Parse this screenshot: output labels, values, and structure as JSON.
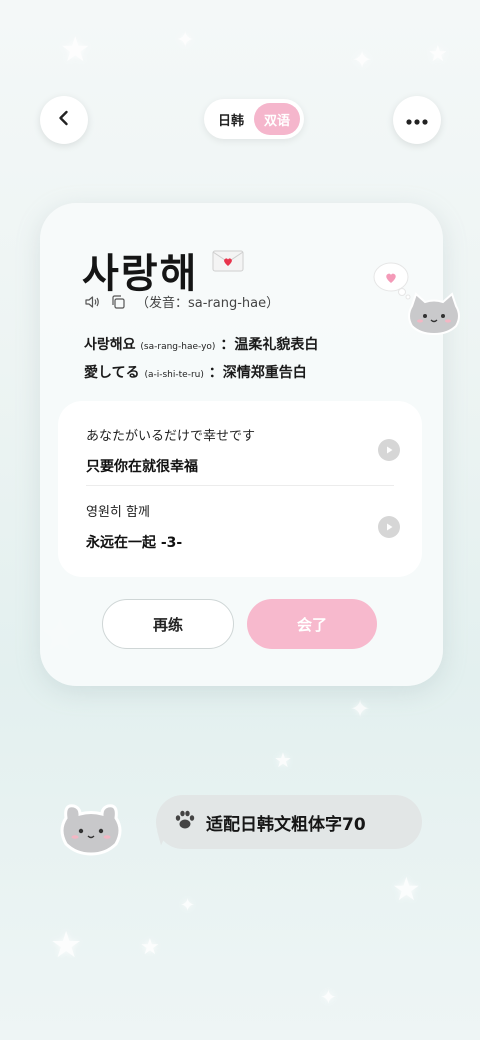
{
  "header": {
    "toggle": {
      "option_a": "日韩",
      "option_b": "双语",
      "active": "option_b"
    }
  },
  "card": {
    "word": "사랑해",
    "pronunciation": "（发音：sa-rang-hae）",
    "forms": [
      {
        "text": "사랑해요",
        "roman": "(sa-rang-hae-yo)",
        "meaning": "：温柔礼貌表白"
      },
      {
        "text": "愛してる",
        "roman": "(a-i-shi-te-ru)",
        "meaning": "：深情郑重告白"
      }
    ],
    "examples": [
      {
        "source": "あなたがいるだけで幸せです",
        "translation": "只要你在就很幸福"
      },
      {
        "source": "영원히  함께",
        "translation": "永远在一起  -3-"
      }
    ],
    "buttons": {
      "retry": "再练",
      "done": "会了"
    }
  },
  "banner": {
    "text": "适配日韩文粗体字70"
  },
  "icons": {
    "back": "chevron-left-icon",
    "more": "more-horizontal-icon",
    "speaker": "speaker-icon",
    "copy": "copy-icon",
    "play": "play-icon",
    "envelope": "love-letter-icon",
    "paw": "paw-icon"
  },
  "colors": {
    "accent_pink": "#f5b6cc",
    "button_pink": "#f7b9cd",
    "card_bg": "#f7fafa"
  }
}
